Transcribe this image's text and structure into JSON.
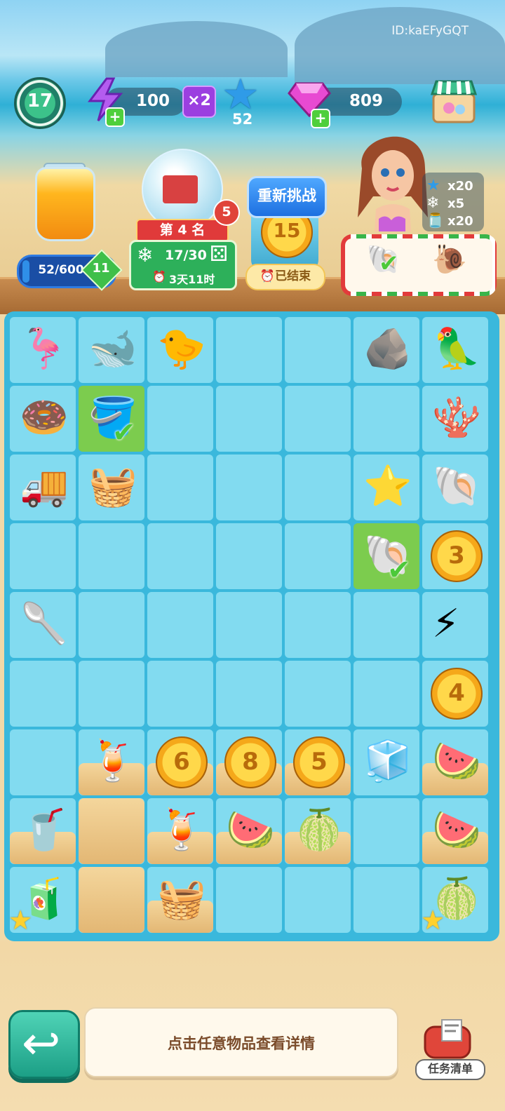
{
  "account": {
    "id": "ID:kaEFyGQT"
  },
  "player": {
    "level": "17"
  },
  "resources": {
    "energy": "100",
    "energy_multiplier": "×2",
    "stars": "52",
    "gems": "809"
  },
  "jar": {
    "progress_text": "52/600",
    "progress_fraction": 0.087,
    "level": "11"
  },
  "event": {
    "rank": "第 4 名",
    "badge": "5",
    "progress": "17/30",
    "time_left": "3天11时"
  },
  "challenge": {
    "retry_label": "重新挑战",
    "coin_value": "15",
    "status": "已结束"
  },
  "rewards": [
    {
      "icon": "star-icon",
      "amount": "x20"
    },
    {
      "icon": "snowflake-icon",
      "amount": "x5"
    },
    {
      "icon": "jar-icon",
      "amount": "x20"
    }
  ],
  "order": {
    "items": [
      "shell-icon (done)",
      "conch-icon"
    ]
  },
  "board": {
    "coins": [
      {
        "row": 3,
        "col": 6,
        "value": "3"
      },
      {
        "row": 5,
        "col": 6,
        "value": "4"
      },
      {
        "row": 6,
        "col": 2,
        "value": "6"
      },
      {
        "row": 6,
        "col": 3,
        "value": "8"
      },
      {
        "row": 6,
        "col": 4,
        "value": "5"
      }
    ],
    "items": [
      {
        "row": 0,
        "col": 0,
        "name": "flamingo-float-icon",
        "symbol": "🦩"
      },
      {
        "row": 0,
        "col": 1,
        "name": "whale-float-icon",
        "symbol": "🐋"
      },
      {
        "row": 0,
        "col": 2,
        "name": "parrot-chick-icon",
        "symbol": "🐤"
      },
      {
        "row": 0,
        "col": 5,
        "name": "rocks-icon",
        "symbol": "🪨"
      },
      {
        "row": 0,
        "col": 6,
        "name": "parrot-icon",
        "symbol": "🦜"
      },
      {
        "row": 1,
        "col": 0,
        "name": "donut-float-icon",
        "symbol": "🍩"
      },
      {
        "row": 1,
        "col": 1,
        "name": "sand-bucket-icon",
        "symbol": "🪣"
      },
      {
        "row": 1,
        "col": 6,
        "name": "coral-rock-icon",
        "symbol": "🪸"
      },
      {
        "row": 2,
        "col": 0,
        "name": "toy-truck-icon",
        "symbol": "🚚"
      },
      {
        "row": 2,
        "col": 1,
        "name": "snack-cart-icon",
        "symbol": "🧺"
      },
      {
        "row": 2,
        "col": 5,
        "name": "starfish-icon",
        "symbol": "⭐"
      },
      {
        "row": 2,
        "col": 6,
        "name": "coral-shell-icon",
        "symbol": "🐚"
      },
      {
        "row": 3,
        "col": 5,
        "name": "shell-icon",
        "symbol": "🐚"
      },
      {
        "row": 4,
        "col": 0,
        "name": "sand-shovel-icon",
        "symbol": "🥄"
      },
      {
        "row": 4,
        "col": 6,
        "name": "energy-bolts-icon",
        "symbol": "⚡"
      },
      {
        "row": 6,
        "col": 1,
        "name": "watermelon-juice-icon",
        "symbol": "🍹"
      },
      {
        "row": 6,
        "col": 5,
        "name": "cooler-box-icon",
        "symbol": "🧊"
      },
      {
        "row": 6,
        "col": 6,
        "name": "watermelon-slice-icon",
        "symbol": "🍉"
      },
      {
        "row": 7,
        "col": 0,
        "name": "juice-glass-icon",
        "symbol": "🥤"
      },
      {
        "row": 7,
        "col": 2,
        "name": "juice-pitcher-icon",
        "symbol": "🍹"
      },
      {
        "row": 7,
        "col": 3,
        "name": "watermelon-half-icon",
        "symbol": "🍉"
      },
      {
        "row": 7,
        "col": 4,
        "name": "watermelon-icon",
        "symbol": "🍈"
      },
      {
        "row": 7,
        "col": 6,
        "name": "watermelon-plate-icon",
        "symbol": "🍉"
      },
      {
        "row": 8,
        "col": 0,
        "name": "juicer-generator-icon",
        "symbol": "🧃"
      },
      {
        "row": 8,
        "col": 2,
        "name": "surfboard-basket-icon",
        "symbol": "🧺"
      },
      {
        "row": 8,
        "col": 6,
        "name": "watermelon-pile-icon",
        "symbol": "🍈"
      }
    ]
  },
  "bottom": {
    "hint": "点击任意物品查看详情",
    "tasks_label": "任务清单"
  }
}
